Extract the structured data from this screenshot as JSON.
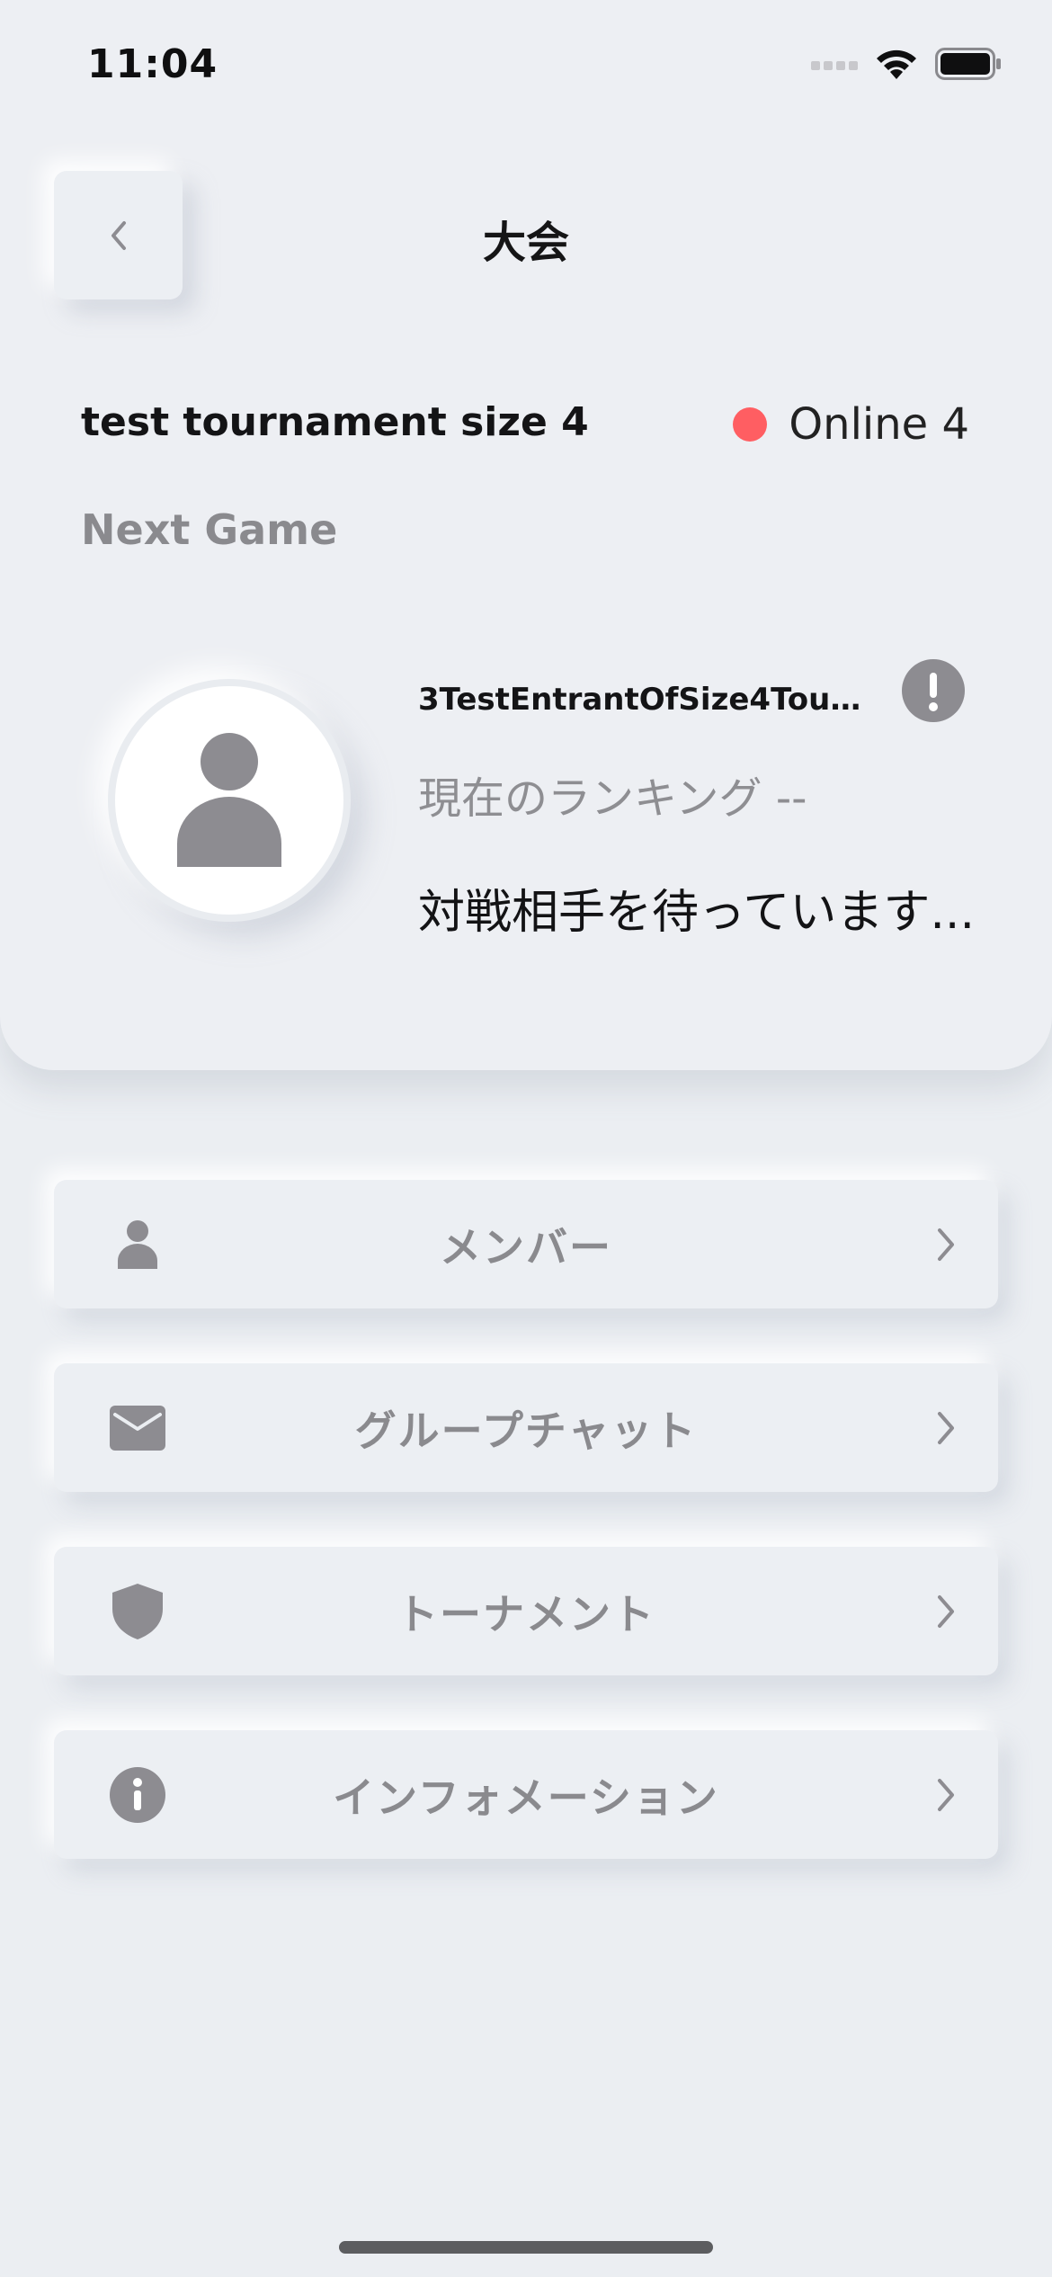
{
  "status_bar": {
    "time": "11:04"
  },
  "header": {
    "title": "大会",
    "back_icon": "chevron-left-icon"
  },
  "tournament": {
    "name": "test tournament size 4",
    "online_label": "Online 4",
    "online_dot_color": "#ff5e62",
    "next_game_label": "Next Game"
  },
  "next_game": {
    "entrant_name": "3TestEntrantOfSize4Tourn...",
    "ranking": "現在のランキング --",
    "status": "対戦相手を待っています..."
  },
  "menu": {
    "items": [
      {
        "label": "メンバー",
        "icon": "person-icon"
      },
      {
        "label": "グループチャット",
        "icon": "envelope-icon"
      },
      {
        "label": "トーナメント",
        "icon": "shield-icon"
      },
      {
        "label": "インフォメーション",
        "icon": "info-icon"
      }
    ]
  },
  "colors": {
    "background": "#ebeef2",
    "muted_text": "#8a8a8e",
    "icon_gray": "#8d8c91"
  }
}
